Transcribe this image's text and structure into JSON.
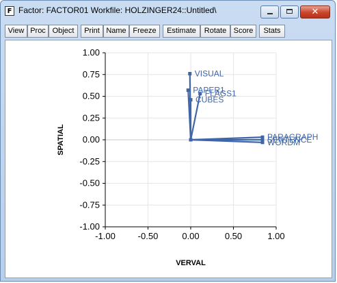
{
  "window": {
    "app_icon_letter": "F",
    "title": "Factor: FACTOR01   Workfile: HOLZINGER24::Untitled\\",
    "close_glyph": "✕"
  },
  "toolbar": {
    "buttons": [
      "View",
      "Proc",
      "Object",
      "Print",
      "Name",
      "Freeze",
      "Estimate",
      "Rotate",
      "Score",
      "Stats"
    ]
  },
  "colors": {
    "series": "#3f66a8",
    "grid": "#e6e6e6",
    "axis": "#000000"
  },
  "chart_data": {
    "type": "scatter",
    "style": "loadings plot with vectors from origin",
    "xlabel": "VERVAL",
    "ylabel": "SPATIAL",
    "xlim": [
      -1.0,
      1.0
    ],
    "ylim": [
      -1.0,
      1.0
    ],
    "x_ticks": [
      "-1.00",
      "-0.50",
      "0.00",
      "0.50",
      "1.00"
    ],
    "y_ticks": [
      "1.00",
      "0.75",
      "0.50",
      "0.25",
      "0.00",
      "-0.25",
      "-0.50",
      "-0.75",
      "-1.00"
    ],
    "x_tick_values": [
      -1.0,
      -0.5,
      0.0,
      0.5,
      1.0
    ],
    "y_tick_values": [
      1.0,
      0.75,
      0.5,
      0.25,
      0.0,
      -0.25,
      -0.5,
      -0.75,
      -1.0
    ],
    "grid": true,
    "points": [
      {
        "label": "VISUAL",
        "x": -0.01,
        "y": 0.76
      },
      {
        "label": "PAPER1",
        "x": -0.03,
        "y": 0.57
      },
      {
        "label": "FLAGS1",
        "x": 0.11,
        "y": 0.53
      },
      {
        "label": "CUBES",
        "x": 0.0,
        "y": 0.46
      },
      {
        "label": "PARAGRAPH",
        "x": 0.84,
        "y": 0.03
      },
      {
        "label": "SENTENCE",
        "x": 0.84,
        "y": 0.0
      },
      {
        "label": "WORDM",
        "x": 0.84,
        "y": -0.03
      }
    ]
  }
}
